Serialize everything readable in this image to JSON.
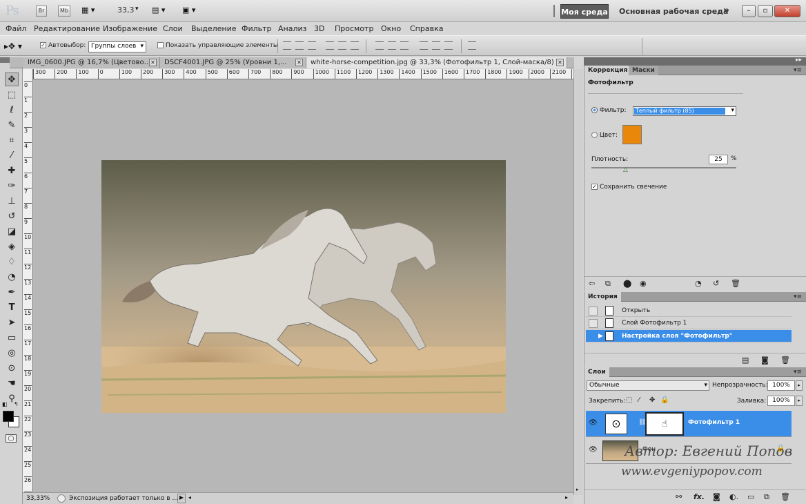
{
  "app": {
    "logo": "Ps",
    "br": "Br",
    "mb": "Mb",
    "zoom": "33,3",
    "workspace_active": "Моя среда",
    "workspace_main": "Основная рабочая среда",
    "more": "»"
  },
  "menu": [
    "Файл",
    "Редактирование",
    "Изображение",
    "Слои",
    "Выделение",
    "Фильтр",
    "Анализ",
    "3D",
    "Просмотр",
    "Окно",
    "Справка"
  ],
  "options": {
    "autoselect_label": "Автовыбор:",
    "autoselect_value": "Группы слоев",
    "show_controls": "Показать управляющие элементы"
  },
  "tabs": [
    {
      "label": "IMG_0600.JPG @ 16,7% (Цветово...",
      "close": "✕"
    },
    {
      "label": "DSCF4001.JPG @ 25% (Уровни 1,...",
      "close": "✕"
    },
    {
      "label": "white-horse-competition.jpg @ 33,3% (Фотофильтр 1, Слой-маска/8) *",
      "close": "✕"
    }
  ],
  "ruler_h": [
    "300",
    "200",
    "100",
    "0",
    "100",
    "200",
    "300",
    "400",
    "500",
    "600",
    "700",
    "800",
    "900",
    "1000",
    "1100",
    "1200",
    "1300",
    "1400",
    "1500",
    "1600",
    "1700",
    "1800",
    "1900",
    "2000",
    "2100",
    "22"
  ],
  "ruler_v": [
    "0",
    "1",
    "2",
    "3",
    "4",
    "5",
    "6",
    "7",
    "8",
    "9",
    "10",
    "11",
    "12",
    "13",
    "14",
    "15",
    "16",
    "17",
    "18",
    "19",
    "20",
    "21",
    "22",
    "23",
    "24",
    "25",
    "26",
    "27"
  ],
  "status": {
    "zoom": "33,33%",
    "message": "Экспозиция работает только в ..."
  },
  "correction": {
    "tabs": [
      "Коррекция",
      "Маски"
    ],
    "title": "Фотофильтр",
    "filter_label": "Фильтр:",
    "filter_value": "Теплый фильтр (85)",
    "color_label": "Цвет:",
    "color_swatch": "#e8870a",
    "density_label": "Плотность:",
    "density_value": "25",
    "density_unit": "%",
    "density_level": 0.25,
    "preserve_label": "Сохранить свечение"
  },
  "history": {
    "tab": "История",
    "items": [
      "Открыть",
      "Слой Фотофильтр 1",
      "Настройка слоя \"Фотофильтр\""
    ]
  },
  "layers": {
    "tab": "Слои",
    "blend_mode": "Обычные",
    "opacity_label": "Непрозрачность:",
    "opacity_value": "100%",
    "lock_label": "Закрепить:",
    "fill_label": "Заливка:",
    "fill_value": "100%",
    "items": [
      {
        "name": "Фотофильтр 1"
      },
      {
        "name": "Фон"
      }
    ]
  },
  "watermark": {
    "author": "Автор: Евгений Попов",
    "site": "www.evgeniypopov.com"
  },
  "colors": {
    "accent": "#3b8ee8",
    "foreground": "#000000",
    "background": "#ffffff"
  }
}
